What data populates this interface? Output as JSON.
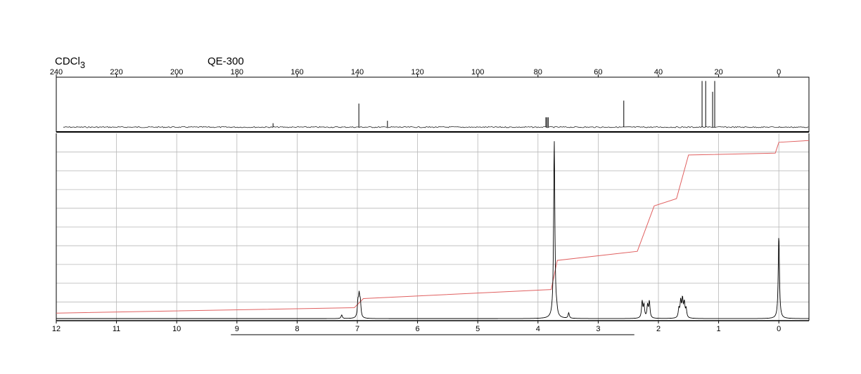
{
  "header": {
    "solvent": "CDCl",
    "solvent_subscript": "3",
    "instrument": "QE-300"
  },
  "chart_data": [
    {
      "type": "line",
      "name": "13C NMR spectrum",
      "x_unit": "ppm",
      "xlim": [
        240,
        -10
      ],
      "x_reversed": true,
      "tick_labels": [
        "240",
        "220",
        "200",
        "180",
        "160",
        "140",
        "120",
        "100",
        "80",
        "60",
        "40",
        "20",
        "0"
      ],
      "ticks": [
        240,
        220,
        200,
        180,
        160,
        140,
        120,
        100,
        80,
        60,
        40,
        20,
        0
      ],
      "axis_position": "top",
      "baseline": 0.04,
      "peaks": [
        {
          "x": 168.0,
          "y": 0.12
        },
        {
          "x": 139.5,
          "y": 0.52
        },
        {
          "x": 130.0,
          "y": 0.17
        },
        {
          "x": 77.4,
          "y": 0.24
        },
        {
          "x": 77.0,
          "y": 0.24
        },
        {
          "x": 76.6,
          "y": 0.24
        },
        {
          "x": 51.5,
          "y": 0.58
        },
        {
          "x": 25.5,
          "y": 0.98
        },
        {
          "x": 24.3,
          "y": 0.98
        },
        {
          "x": 22.0,
          "y": 0.76
        },
        {
          "x": 21.3,
          "y": 0.98
        },
        {
          "x": 0.0,
          "y": 0.05
        }
      ]
    },
    {
      "type": "line",
      "name": "1H NMR spectrum",
      "x_unit": "ppm",
      "xlim": [
        12,
        -0.5
      ],
      "x_reversed": true,
      "tick_labels": [
        "12",
        "11",
        "10",
        "9",
        "8",
        "7",
        "6",
        "5",
        "4",
        "3",
        "2",
        "1",
        "0"
      ],
      "ticks": [
        12,
        11,
        10,
        9,
        8,
        7,
        6,
        5,
        4,
        3,
        2,
        1,
        0
      ],
      "axis_position": "bottom",
      "grid": true,
      "peaks": [
        {
          "x": 7.26,
          "y": 0.02
        },
        {
          "x": 6.99,
          "y": 0.08
        },
        {
          "x": 6.97,
          "y": 0.11
        },
        {
          "x": 6.95,
          "y": 0.08
        },
        {
          "x": 3.73,
          "y": 0.98
        },
        {
          "x": 3.69,
          "y": 0.03
        },
        {
          "x": 3.49,
          "y": 0.03
        },
        {
          "x": 2.27,
          "y": 0.09
        },
        {
          "x": 2.24,
          "y": 0.07
        },
        {
          "x": 2.18,
          "y": 0.07
        },
        {
          "x": 2.15,
          "y": 0.09
        },
        {
          "x": 1.66,
          "y": 0.05
        },
        {
          "x": 1.63,
          "y": 0.09
        },
        {
          "x": 1.6,
          "y": 0.1
        },
        {
          "x": 1.57,
          "y": 0.08
        },
        {
          "x": 1.54,
          "y": 0.05
        },
        {
          "x": 0.0,
          "y": 0.46
        }
      ],
      "integral": [
        {
          "x": 12.0,
          "y": 0.03
        },
        {
          "x": 7.05,
          "y": 0.06
        },
        {
          "x": 6.9,
          "y": 0.11
        },
        {
          "x": 3.78,
          "y": 0.16
        },
        {
          "x": 3.68,
          "y": 0.32
        },
        {
          "x": 2.35,
          "y": 0.37
        },
        {
          "x": 2.07,
          "y": 0.62
        },
        {
          "x": 1.7,
          "y": 0.66
        },
        {
          "x": 1.5,
          "y": 0.9
        },
        {
          "x": 0.06,
          "y": 0.91
        },
        {
          "x": 0.0,
          "y": 0.97
        },
        {
          "x": -0.5,
          "y": 0.98
        }
      ],
      "integral_color": "#e06060",
      "trace_color": "#000000",
      "bracket": [
        9.1,
        2.4
      ]
    }
  ]
}
